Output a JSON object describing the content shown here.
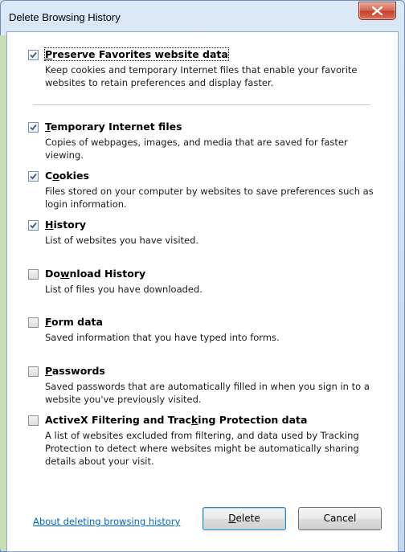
{
  "window": {
    "title": "Delete Browsing History"
  },
  "options": [
    {
      "title": "Preserve Favorites website data",
      "underline_index": 0,
      "checked": true,
      "desc": "Keep cookies and temporary Internet files that enable your favorite websites to retain preferences and display faster."
    },
    {
      "title": "Temporary Internet files",
      "underline_index": 0,
      "checked": true,
      "desc": "Copies of webpages, images, and media that are saved for faster viewing."
    },
    {
      "title": "Cookies",
      "underline_index": 1,
      "checked": true,
      "desc": "Files stored on your computer by websites to save preferences such as login information."
    },
    {
      "title": "History",
      "underline_index": 0,
      "checked": true,
      "desc": "List of websites you have visited."
    },
    {
      "title": "Download History",
      "underline_index": 2,
      "checked": false,
      "desc": "List of files you have downloaded."
    },
    {
      "title": "Form data",
      "underline_index": 0,
      "checked": false,
      "desc": "Saved information that you have typed into forms."
    },
    {
      "title": "Passwords",
      "underline_index": 0,
      "checked": false,
      "desc": "Saved passwords that are automatically filled in when you sign in to a website you've previously visited."
    },
    {
      "title": "ActiveX Filtering and Tracking Protection data",
      "underline_index": 26,
      "checked": false,
      "desc": "A list of websites excluded from filtering, and data used by Tracking Protection to detect where websites might be automatically sharing details about your visit."
    }
  ],
  "footer": {
    "link": "About deleting browsing history",
    "delete_label": "Delete",
    "cancel_label": "Cancel"
  },
  "icons": {
    "close": "close-icon",
    "check": "checkmark-icon"
  },
  "colors": {
    "link": "#0066cc",
    "close_button": "#c5412a"
  }
}
